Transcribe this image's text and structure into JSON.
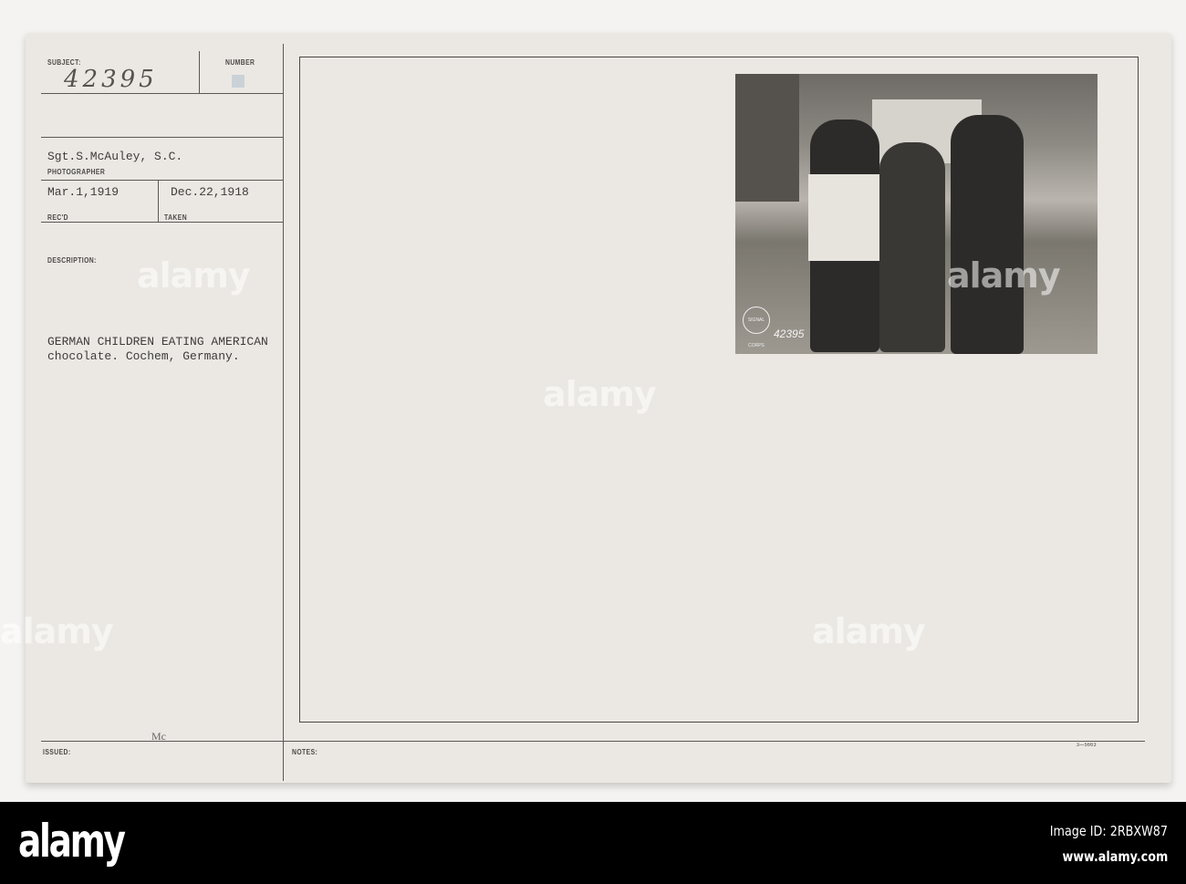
{
  "card": {
    "subject_label": "SUBJECT:",
    "subject_number": "42395",
    "number_label": "NUMBER",
    "photographer": "Sgt.S.McAuley, S.C.",
    "photographer_label": "PHOTOGRAPHER",
    "received": "Mar.1,1919",
    "received_label": "REC'D",
    "taken": "Dec.22,1918",
    "taken_label": "TAKEN",
    "description_label": "DESCRIPTION:",
    "description_line1": "GERMAN CHILDREN EATING AMERICAN",
    "description_line2": "chocolate. Cochem, Germany.",
    "issued_initials": "Mc",
    "issued_label": "ISSUED:",
    "notes_label": "NOTES:",
    "form_number": "3—5663"
  },
  "photo": {
    "stamp_text": "SIGNAL CORPS USA",
    "photo_number": "42395"
  },
  "watermark": {
    "text": "alamy"
  },
  "footer": {
    "logo": "alamy",
    "image_id": "Image ID: 2RBXW87",
    "url": "www.alamy.com"
  }
}
